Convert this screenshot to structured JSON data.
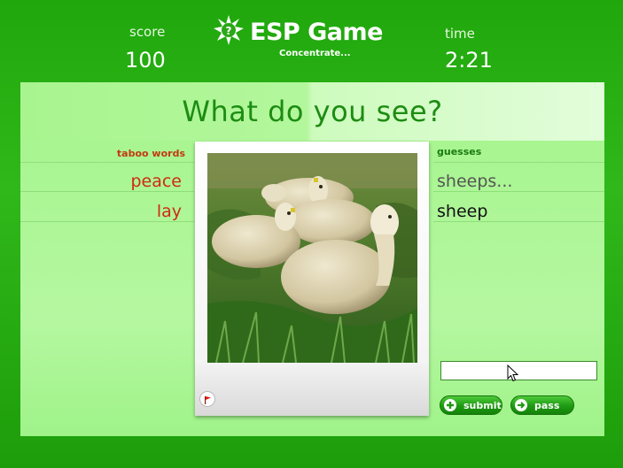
{
  "header": {
    "score_label": "score",
    "score_value": "100",
    "time_label": "time",
    "time_value": "2:21",
    "logo_title": "ESP Game",
    "logo_subtitle": "Concentrate..."
  },
  "main": {
    "question": "What do you see?",
    "taboo_header": "taboo words",
    "taboo_words": [
      "peace",
      "lay"
    ],
    "guesses_header": "guesses",
    "guesses": [
      "sheeps...",
      "sheep"
    ],
    "guess_input_value": "",
    "submit_label": "submit",
    "pass_label": "pass"
  },
  "icons": {
    "logo": "star-question-icon",
    "report": "red-flag-icon",
    "submit": "plus-icon",
    "pass": "arrow-right-icon",
    "cursor": "mouse-pointer-icon"
  },
  "colors": {
    "background_green": "#22a80f",
    "panel_green": "#b3f79c",
    "question_green": "#1d8c12",
    "taboo_red": "#d12a10",
    "button_green": "#1e9a12"
  }
}
